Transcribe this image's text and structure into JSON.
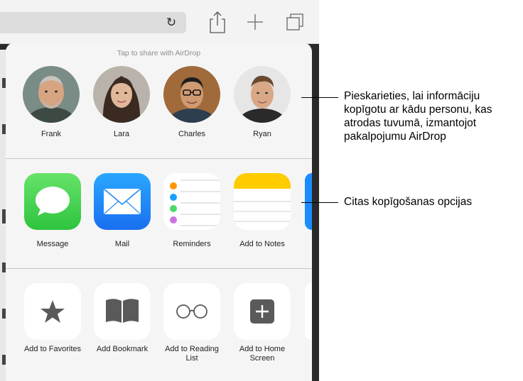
{
  "toolbar": {
    "reload_icon": "reload-icon",
    "share_icon": "share-icon",
    "new_tab_icon": "plus-icon",
    "tabs_icon": "tabs-icon"
  },
  "share_sheet": {
    "airdrop_header": "Tap to share with AirDrop",
    "people": [
      {
        "name": "Frank"
      },
      {
        "name": "Lara"
      },
      {
        "name": "Charles"
      },
      {
        "name": "Ryan"
      }
    ],
    "apps": [
      {
        "label": "Message",
        "color": "#4cd964"
      },
      {
        "label": "Mail",
        "color": "#1e90ff"
      },
      {
        "label": "Reminders",
        "color": "#ffffff"
      },
      {
        "label": "Add to Notes",
        "color": "#ffcc00"
      }
    ],
    "actions": [
      {
        "label": "Add to Favorites",
        "icon": "star-icon"
      },
      {
        "label": "Add Bookmark",
        "icon": "book-icon"
      },
      {
        "label": "Add to Reading List",
        "icon": "glasses-icon"
      },
      {
        "label": "Add to Home Screen",
        "icon": "plus-square-icon"
      }
    ]
  },
  "callouts": {
    "airdrop": "Pieskarieties, lai informāciju kopīgotu ar kādu personu, kas atrodas tuvumā, izmantojot pakalpojumu AirDrop",
    "share_options": "Citas kopīgošanas opcijas"
  }
}
